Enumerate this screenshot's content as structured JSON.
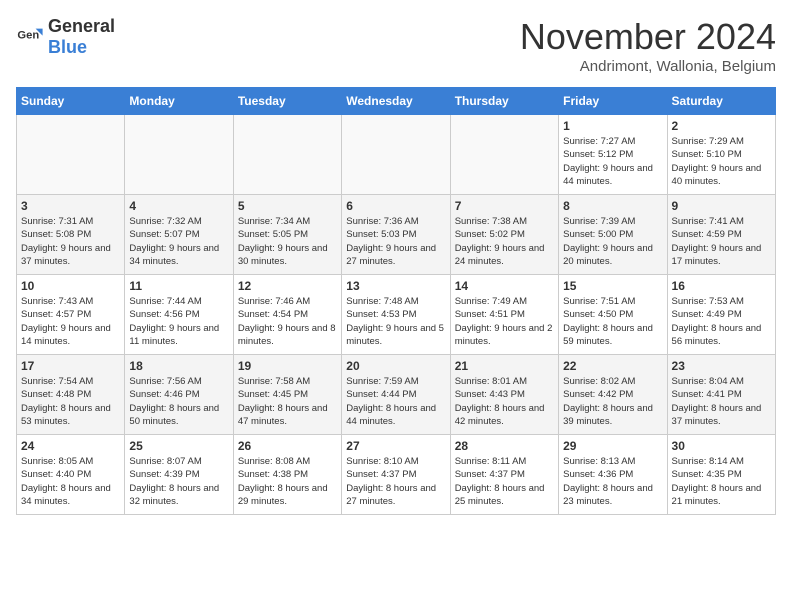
{
  "logo": {
    "text_general": "General",
    "text_blue": "Blue"
  },
  "title": "November 2024",
  "subtitle": "Andrimont, Wallonia, Belgium",
  "days_of_week": [
    "Sunday",
    "Monday",
    "Tuesday",
    "Wednesday",
    "Thursday",
    "Friday",
    "Saturday"
  ],
  "weeks": [
    [
      {
        "day": "",
        "info": ""
      },
      {
        "day": "",
        "info": ""
      },
      {
        "day": "",
        "info": ""
      },
      {
        "day": "",
        "info": ""
      },
      {
        "day": "",
        "info": ""
      },
      {
        "day": "1",
        "info": "Sunrise: 7:27 AM\nSunset: 5:12 PM\nDaylight: 9 hours and 44 minutes."
      },
      {
        "day": "2",
        "info": "Sunrise: 7:29 AM\nSunset: 5:10 PM\nDaylight: 9 hours and 40 minutes."
      }
    ],
    [
      {
        "day": "3",
        "info": "Sunrise: 7:31 AM\nSunset: 5:08 PM\nDaylight: 9 hours and 37 minutes."
      },
      {
        "day": "4",
        "info": "Sunrise: 7:32 AM\nSunset: 5:07 PM\nDaylight: 9 hours and 34 minutes."
      },
      {
        "day": "5",
        "info": "Sunrise: 7:34 AM\nSunset: 5:05 PM\nDaylight: 9 hours and 30 minutes."
      },
      {
        "day": "6",
        "info": "Sunrise: 7:36 AM\nSunset: 5:03 PM\nDaylight: 9 hours and 27 minutes."
      },
      {
        "day": "7",
        "info": "Sunrise: 7:38 AM\nSunset: 5:02 PM\nDaylight: 9 hours and 24 minutes."
      },
      {
        "day": "8",
        "info": "Sunrise: 7:39 AM\nSunset: 5:00 PM\nDaylight: 9 hours and 20 minutes."
      },
      {
        "day": "9",
        "info": "Sunrise: 7:41 AM\nSunset: 4:59 PM\nDaylight: 9 hours and 17 minutes."
      }
    ],
    [
      {
        "day": "10",
        "info": "Sunrise: 7:43 AM\nSunset: 4:57 PM\nDaylight: 9 hours and 14 minutes."
      },
      {
        "day": "11",
        "info": "Sunrise: 7:44 AM\nSunset: 4:56 PM\nDaylight: 9 hours and 11 minutes."
      },
      {
        "day": "12",
        "info": "Sunrise: 7:46 AM\nSunset: 4:54 PM\nDaylight: 9 hours and 8 minutes."
      },
      {
        "day": "13",
        "info": "Sunrise: 7:48 AM\nSunset: 4:53 PM\nDaylight: 9 hours and 5 minutes."
      },
      {
        "day": "14",
        "info": "Sunrise: 7:49 AM\nSunset: 4:51 PM\nDaylight: 9 hours and 2 minutes."
      },
      {
        "day": "15",
        "info": "Sunrise: 7:51 AM\nSunset: 4:50 PM\nDaylight: 8 hours and 59 minutes."
      },
      {
        "day": "16",
        "info": "Sunrise: 7:53 AM\nSunset: 4:49 PM\nDaylight: 8 hours and 56 minutes."
      }
    ],
    [
      {
        "day": "17",
        "info": "Sunrise: 7:54 AM\nSunset: 4:48 PM\nDaylight: 8 hours and 53 minutes."
      },
      {
        "day": "18",
        "info": "Sunrise: 7:56 AM\nSunset: 4:46 PM\nDaylight: 8 hours and 50 minutes."
      },
      {
        "day": "19",
        "info": "Sunrise: 7:58 AM\nSunset: 4:45 PM\nDaylight: 8 hours and 47 minutes."
      },
      {
        "day": "20",
        "info": "Sunrise: 7:59 AM\nSunset: 4:44 PM\nDaylight: 8 hours and 44 minutes."
      },
      {
        "day": "21",
        "info": "Sunrise: 8:01 AM\nSunset: 4:43 PM\nDaylight: 8 hours and 42 minutes."
      },
      {
        "day": "22",
        "info": "Sunrise: 8:02 AM\nSunset: 4:42 PM\nDaylight: 8 hours and 39 minutes."
      },
      {
        "day": "23",
        "info": "Sunrise: 8:04 AM\nSunset: 4:41 PM\nDaylight: 8 hours and 37 minutes."
      }
    ],
    [
      {
        "day": "24",
        "info": "Sunrise: 8:05 AM\nSunset: 4:40 PM\nDaylight: 8 hours and 34 minutes."
      },
      {
        "day": "25",
        "info": "Sunrise: 8:07 AM\nSunset: 4:39 PM\nDaylight: 8 hours and 32 minutes."
      },
      {
        "day": "26",
        "info": "Sunrise: 8:08 AM\nSunset: 4:38 PM\nDaylight: 8 hours and 29 minutes."
      },
      {
        "day": "27",
        "info": "Sunrise: 8:10 AM\nSunset: 4:37 PM\nDaylight: 8 hours and 27 minutes."
      },
      {
        "day": "28",
        "info": "Sunrise: 8:11 AM\nSunset: 4:37 PM\nDaylight: 8 hours and 25 minutes."
      },
      {
        "day": "29",
        "info": "Sunrise: 8:13 AM\nSunset: 4:36 PM\nDaylight: 8 hours and 23 minutes."
      },
      {
        "day": "30",
        "info": "Sunrise: 8:14 AM\nSunset: 4:35 PM\nDaylight: 8 hours and 21 minutes."
      }
    ]
  ]
}
